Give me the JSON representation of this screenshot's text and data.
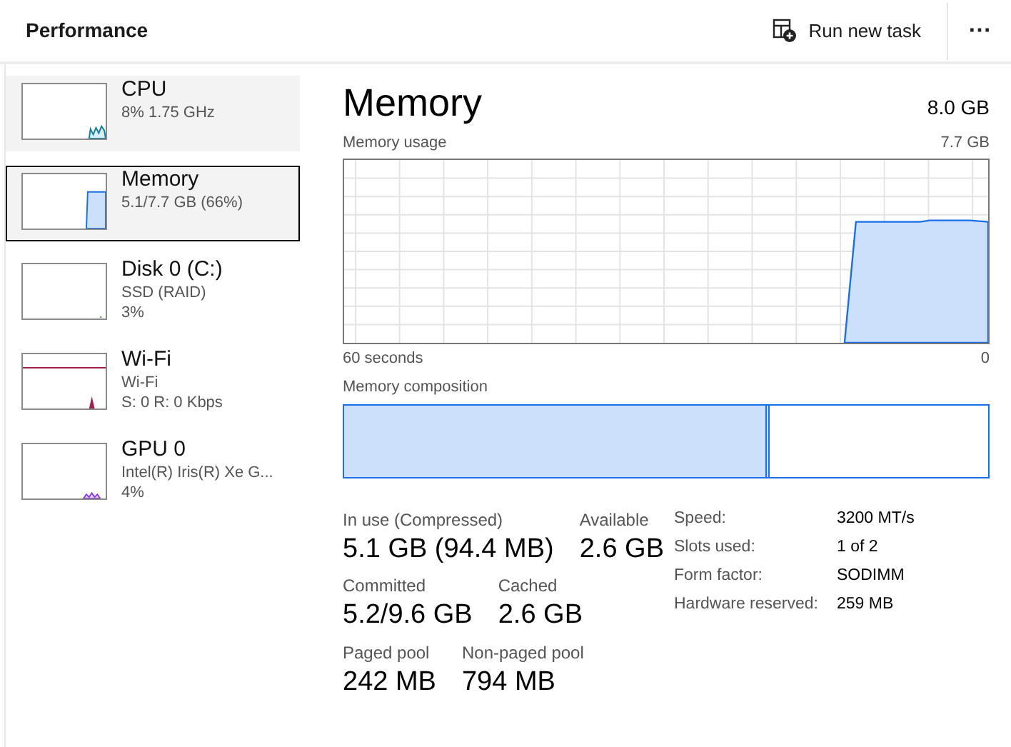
{
  "header": {
    "title": "Performance",
    "run_task_label": "Run new task",
    "more_label": "⋯"
  },
  "sidebar": {
    "items": [
      {
        "kind": "cpu",
        "name": "CPU",
        "lines": [
          "8% 1.75 GHz"
        ],
        "selected": false,
        "highlighted": true
      },
      {
        "kind": "memory",
        "name": "Memory",
        "lines": [
          "5.1/7.7 GB (66%)"
        ],
        "selected": true,
        "highlighted": true
      },
      {
        "kind": "disk",
        "name": "Disk 0 (C:)",
        "lines": [
          "SSD (RAID)",
          "3%"
        ],
        "selected": false,
        "highlighted": false
      },
      {
        "kind": "network",
        "name": "Wi-Fi",
        "lines": [
          "Wi-Fi",
          "S: 0 R: 0 Kbps"
        ],
        "selected": false,
        "highlighted": false
      },
      {
        "kind": "gpu",
        "name": "GPU 0",
        "lines": [
          "Intel(R) Iris(R) Xe G...",
          "4%"
        ],
        "selected": false,
        "highlighted": false
      }
    ]
  },
  "main": {
    "title": "Memory",
    "total": "8.0 GB",
    "usage_label": "Memory usage",
    "usage_max": "7.7 GB",
    "x_start": "60 seconds",
    "x_end": "0",
    "composition_label": "Memory composition",
    "composition": {
      "level": 0.66
    },
    "stat_rows": [
      [
        {
          "label": "In use (Compressed)",
          "value": "5.1 GB (94.4 MB)"
        },
        {
          "label": "Available",
          "value": "2.6 GB"
        }
      ],
      [
        {
          "label": "Committed",
          "value": "5.2/9.6 GB"
        },
        {
          "label": "Cached",
          "value": "2.6 GB"
        }
      ],
      [
        {
          "label": "Paged pool",
          "value": "242 MB"
        },
        {
          "label": "Non-paged pool",
          "value": "794 MB"
        }
      ]
    ],
    "details": [
      {
        "label": "Speed:",
        "value": "3200 MT/s"
      },
      {
        "label": "Slots used:",
        "value": "1 of 2"
      },
      {
        "label": "Form factor:",
        "value": "SODIMM"
      },
      {
        "label": "Hardware reserved:",
        "value": "259 MB"
      }
    ]
  }
}
